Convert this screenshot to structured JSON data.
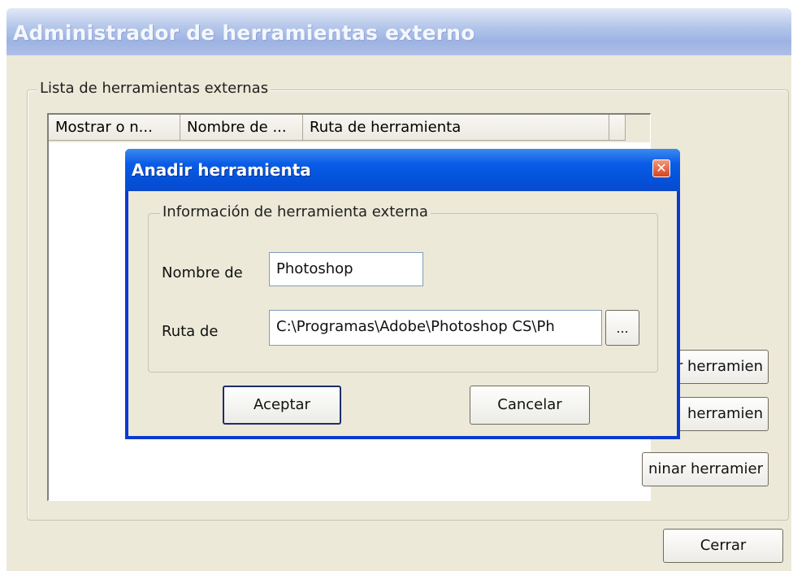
{
  "main_window": {
    "title": "Administrador de herramientas externo",
    "group_label": "Lista de herramientas externas",
    "columns": [
      "Mostrar o n...",
      "Nombre de ...",
      "Ruta de herramienta"
    ],
    "side_buttons": [
      "r herramien",
      "herramien",
      "ninar herramier"
    ],
    "close_label": "Cerrar"
  },
  "dialog": {
    "title": "Anadir herramienta",
    "close_glyph": "✕",
    "group_label": "Información de herramienta externa",
    "name_label": "Nombre de",
    "name_value": "Photoshop",
    "path_label": "Ruta de",
    "path_value": "C:\\Programas\\Adobe\\Photoshop CS\\Ph",
    "browse_label": "...",
    "ok_label": "Aceptar",
    "cancel_label": "Cancelar"
  },
  "colors": {
    "window_bg": "#ece9d8",
    "dialog_title_blue": "#0a5ce6",
    "inactive_title": "#b4c6ea"
  }
}
